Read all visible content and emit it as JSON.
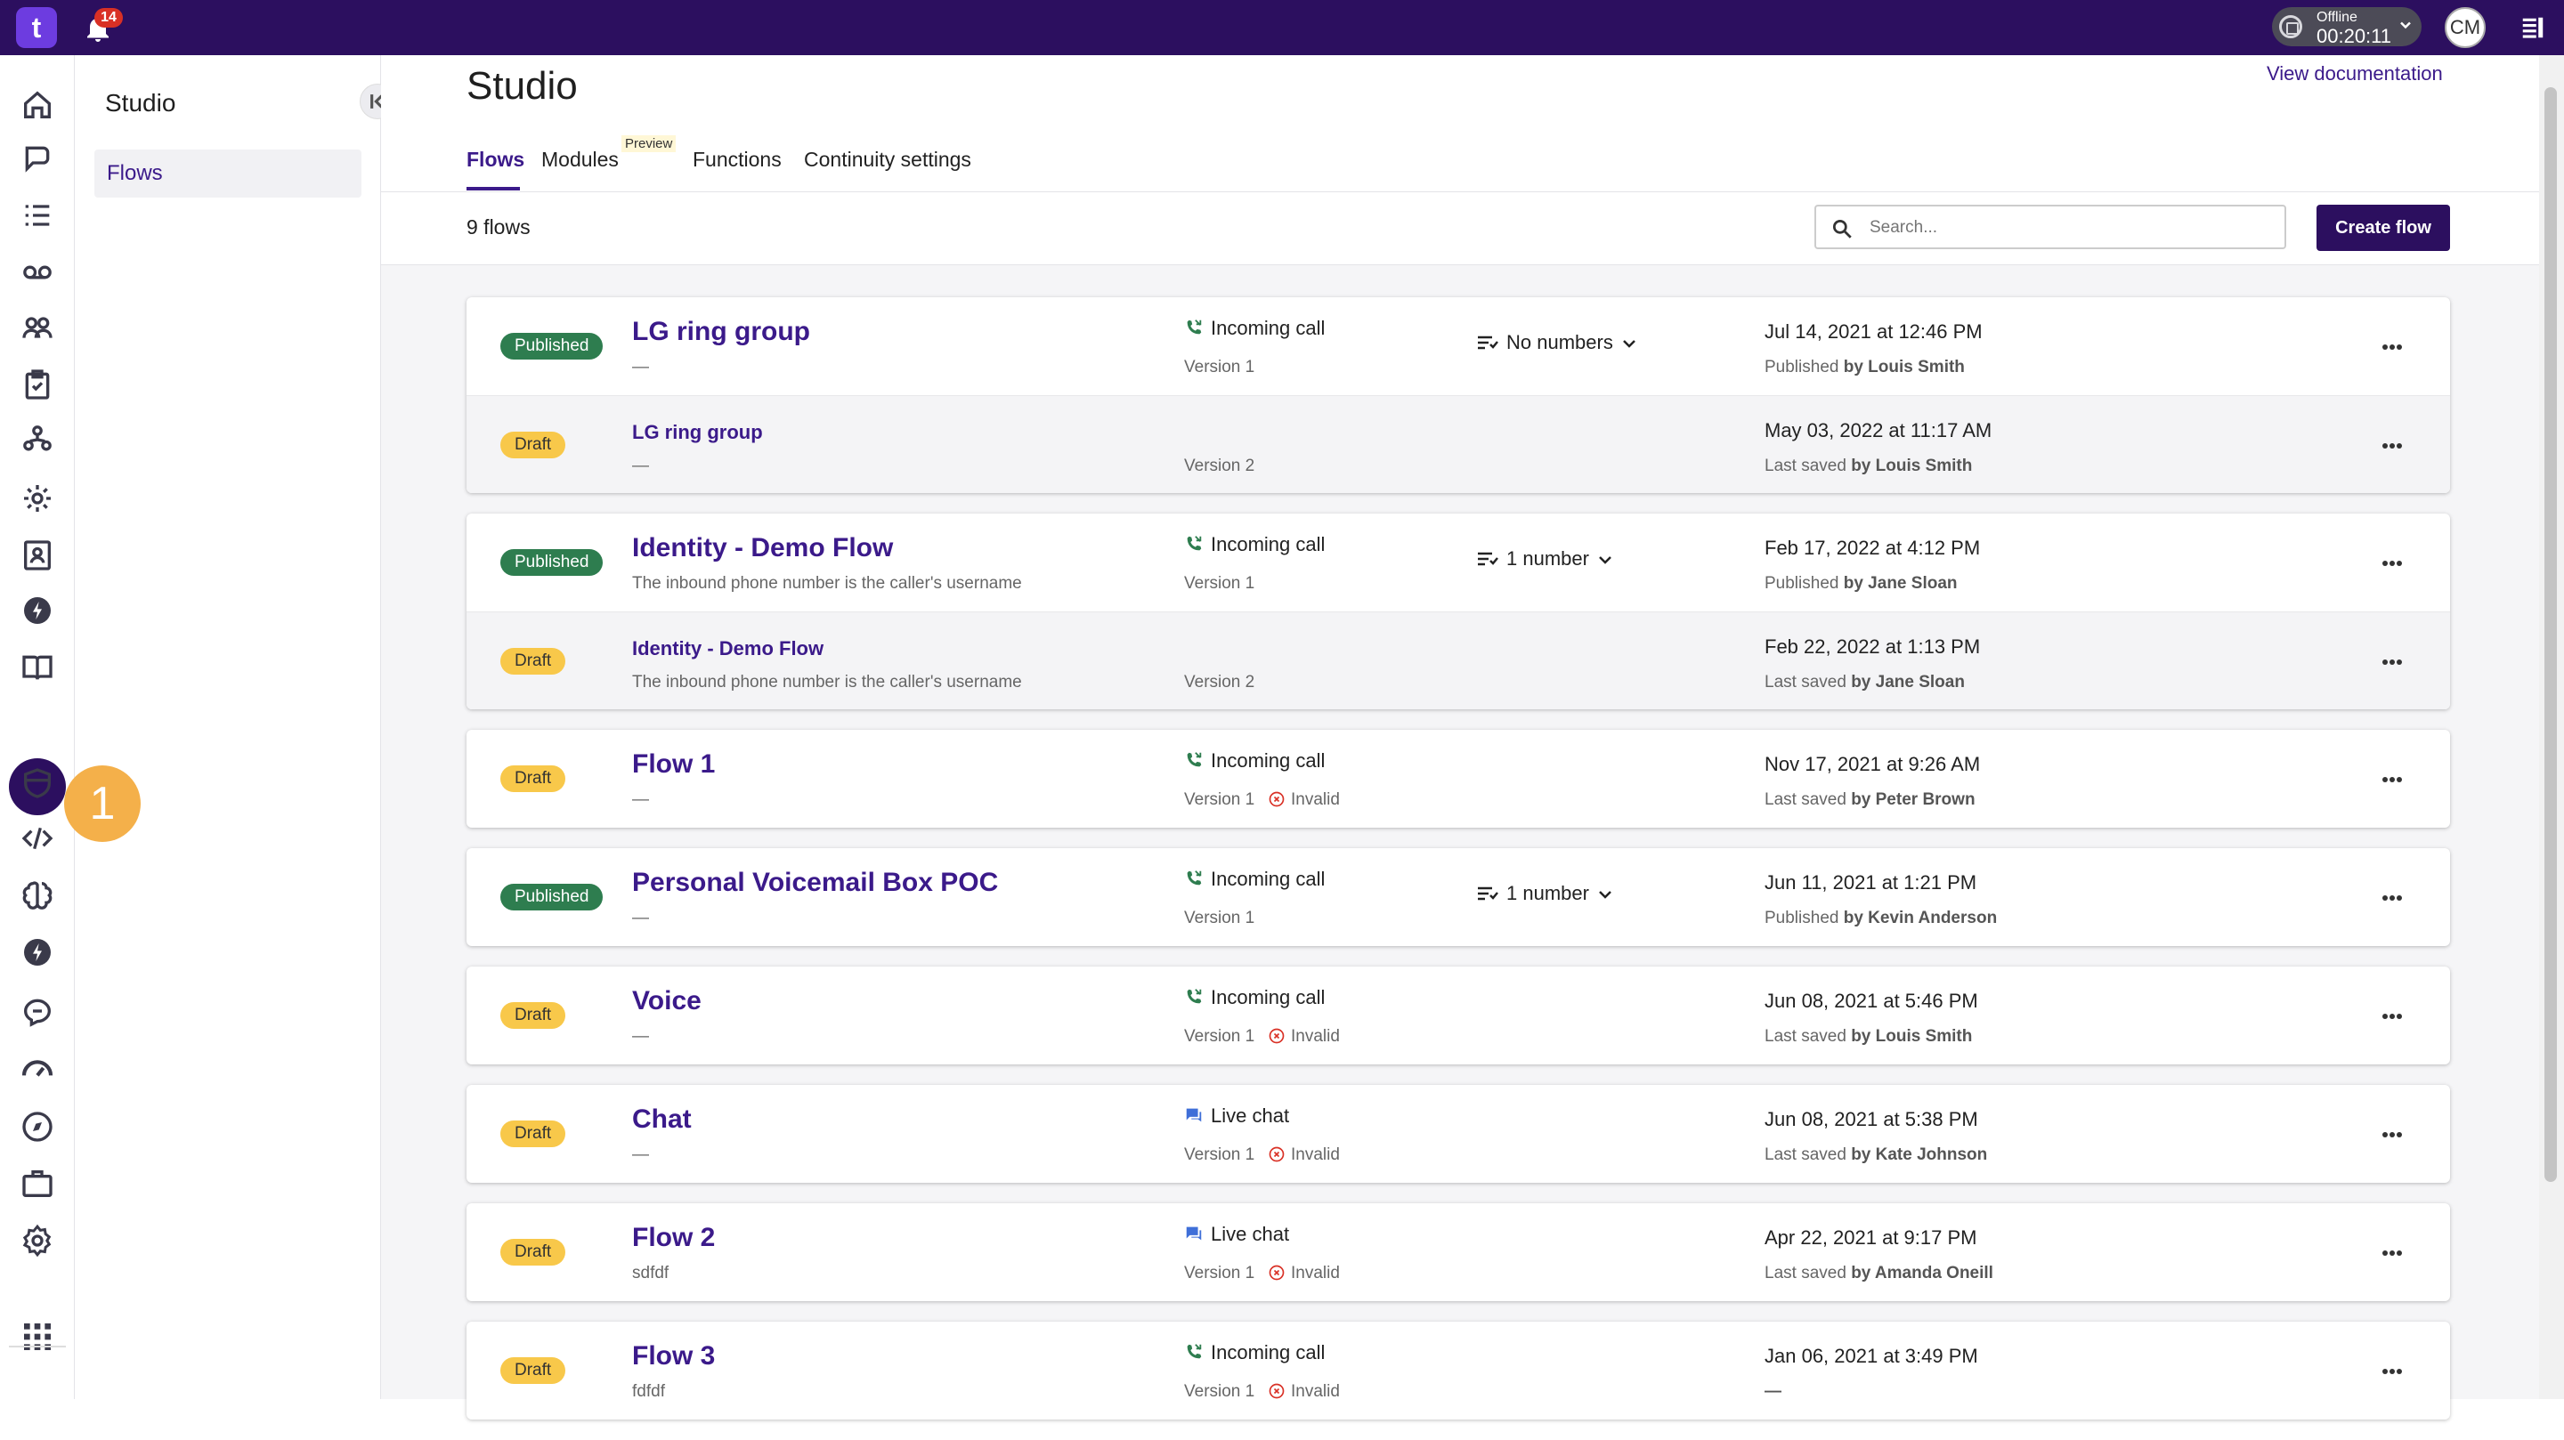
{
  "topbar": {
    "app_logo": "t",
    "notifications_count": "14",
    "presence_status": "Offline",
    "presence_timer": "00:20:11",
    "avatar_initials": "CM"
  },
  "rail": {
    "step_marker": "1",
    "icons": [
      "home-icon",
      "chat-icon",
      "list-icon",
      "voicemail-icon",
      "team-icon",
      "clipboard-icon",
      "org-chart-icon",
      "gear-icon",
      "contact-card-icon",
      "lightning-icon",
      "book-icon",
      "studio-flow-icon",
      "shield-icon",
      "code-icon",
      "brain-icon",
      "lightning-icon",
      "speech-bubble-icon",
      "speedometer-icon",
      "compass-icon",
      "briefcase-icon",
      "settings-icon",
      "app-grid-icon"
    ]
  },
  "subnav": {
    "title": "Studio",
    "items": [
      {
        "label": "Flows"
      }
    ]
  },
  "page": {
    "title": "Studio",
    "view_documentation": "View documentation",
    "tabs": [
      {
        "label": "Flows"
      },
      {
        "label": "Modules",
        "badge": "Preview"
      },
      {
        "label": "Functions"
      },
      {
        "label": "Continuity settings"
      }
    ]
  },
  "toolbar": {
    "count": "9 flows",
    "search_placeholder": "Search...",
    "create_label": "Create flow"
  },
  "colors": {
    "brand": "#2c0f5f",
    "link": "#3b1a8a",
    "published": "#2e7d4f",
    "draft": "#f8c84a"
  },
  "flows": [
    {
      "rows": [
        {
          "status": "Published",
          "name": "LG ring group",
          "desc": "—",
          "type": "Incoming call",
          "version": "Version 1",
          "invalid": "",
          "numbers": "No numbers",
          "date": "Jul 14, 2021 at 12:46 PM",
          "by_prefix": "Published",
          "by_name": "by Louis Smith"
        },
        {
          "status": "Draft",
          "name": "LG ring group",
          "desc": "—",
          "type": "",
          "version": "Version 2",
          "invalid": "",
          "numbers": "",
          "date": "May 03, 2022 at 11:17 AM",
          "by_prefix": "Last saved",
          "by_name": "by Louis Smith"
        }
      ]
    },
    {
      "rows": [
        {
          "status": "Published",
          "name": "Identity - Demo Flow",
          "desc": "The inbound phone number is the caller's username",
          "type": "Incoming call",
          "version": "Version 1",
          "invalid": "",
          "numbers": "1 number",
          "date": "Feb 17, 2022 at 4:12 PM",
          "by_prefix": "Published",
          "by_name": "by Jane Sloan"
        },
        {
          "status": "Draft",
          "name": "Identity - Demo Flow",
          "desc": "The inbound phone number is the caller's username",
          "type": "",
          "version": "Version 2",
          "invalid": "",
          "numbers": "",
          "date": "Feb 22, 2022 at 1:13 PM",
          "by_prefix": "Last saved",
          "by_name": "by Jane Sloan"
        }
      ]
    },
    {
      "rows": [
        {
          "status": "Draft",
          "name": "Flow 1",
          "desc": "—",
          "type": "Incoming call",
          "version": "Version 1",
          "invalid": "Invalid",
          "numbers": "",
          "date": "Nov 17, 2021 at 9:26 AM",
          "by_prefix": "Last saved",
          "by_name": "by Peter Brown"
        }
      ]
    },
    {
      "rows": [
        {
          "status": "Published",
          "name": "Personal Voicemail Box POC",
          "desc": "—",
          "type": "Incoming call",
          "version": "Version 1",
          "invalid": "",
          "numbers": "1 number",
          "date": "Jun 11, 2021 at 1:21 PM",
          "by_prefix": "Published",
          "by_name": "by Kevin Anderson"
        }
      ]
    },
    {
      "rows": [
        {
          "status": "Draft",
          "name": "Voice",
          "desc": "—",
          "type": "Incoming call",
          "version": "Version 1",
          "invalid": "Invalid",
          "numbers": "",
          "date": "Jun 08, 2021 at 5:46 PM",
          "by_prefix": "Last saved",
          "by_name": "by Louis Smith"
        }
      ]
    },
    {
      "rows": [
        {
          "status": "Draft",
          "name": "Chat",
          "desc": "—",
          "type": "Live chat",
          "version": "Version 1",
          "invalid": "Invalid",
          "numbers": "",
          "date": "Jun 08, 2021 at 5:38 PM",
          "by_prefix": "Last saved",
          "by_name": "by Kate Johnson"
        }
      ]
    },
    {
      "rows": [
        {
          "status": "Draft",
          "name": "Flow 2",
          "desc": "sdfdf",
          "type": "Live chat",
          "version": "Version 1",
          "invalid": "Invalid",
          "numbers": "",
          "date": "Apr 22, 2021 at 9:17 PM",
          "by_prefix": "Last saved",
          "by_name": "by Amanda Oneill"
        }
      ]
    },
    {
      "rows": [
        {
          "status": "Draft",
          "name": "Flow 3",
          "desc": "fdfdf",
          "type": "Incoming call",
          "version": "Version 1",
          "invalid": "Invalid",
          "numbers": "",
          "date": "Jan 06, 2021 at 3:49 PM",
          "by_prefix": "",
          "by_name": "—"
        }
      ]
    }
  ]
}
